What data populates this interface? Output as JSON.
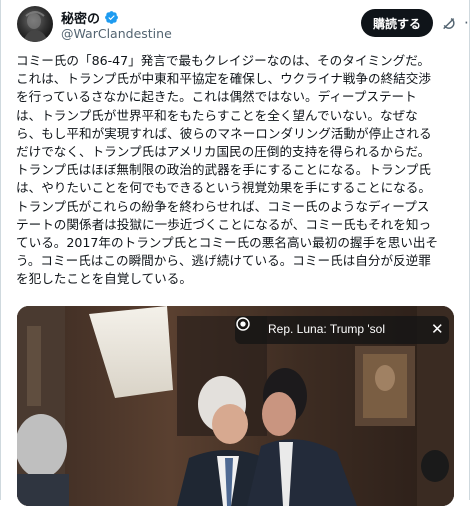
{
  "author": {
    "display_name": "秘密の",
    "handle": "@WarClandestine"
  },
  "actions": {
    "subscribe_label": "購読する",
    "more_label": "···"
  },
  "post": {
    "lines": [
      "コミー氏の「86-47」発言で最もクレイジーなのは、そのタイミングだ。",
      "これは、トランプ氏が中東和平協定を確保し、ウクライナ戦争の終結交渉",
      "を行っているさなかに起きた。これは偶然ではない。ディープステート",
      "は、トランプ氏が世界平和をもたらすことを全く望んでいない。なぜな",
      "ら、もし平和が実現すれば、彼らのマネーロンダリング活動が停止される",
      "だけでなく、トランプ氏はアメリカ国民の圧倒的支持を得られるからだ。",
      "トランプ氏はほぼ無制限の政治的武器を手にすることになる。トランプ氏",
      "は、やりたいことを何でもできるという視覚効果を手にすることになる。",
      "トランプ氏がこれらの紛争を終わらせれば、コミー氏のようなディープス",
      "テートの関係者は投獄に一歩近づくことになるが、コミー氏もそれを知っ",
      "ている。2017年のトランプ氏とコミー氏の悪名高い最初の握手を思い出そ",
      "う。コミー氏はこの瞬間から、逃げ続けている。コミー氏は自分が反逆罪",
      "を犯したことを自覚している。"
    ]
  },
  "media": {
    "caption": "Rep. Luna: Trump 'sol",
    "close_label": "✕"
  },
  "colors": {
    "text": "#0f1419",
    "secondary": "#536471",
    "verified": "#1d9bf0",
    "button": "#0f1419"
  },
  "icons": [
    "verified-badge-icon",
    "grok-icon",
    "more-icon",
    "caption-speaker-icon",
    "close-icon"
  ]
}
